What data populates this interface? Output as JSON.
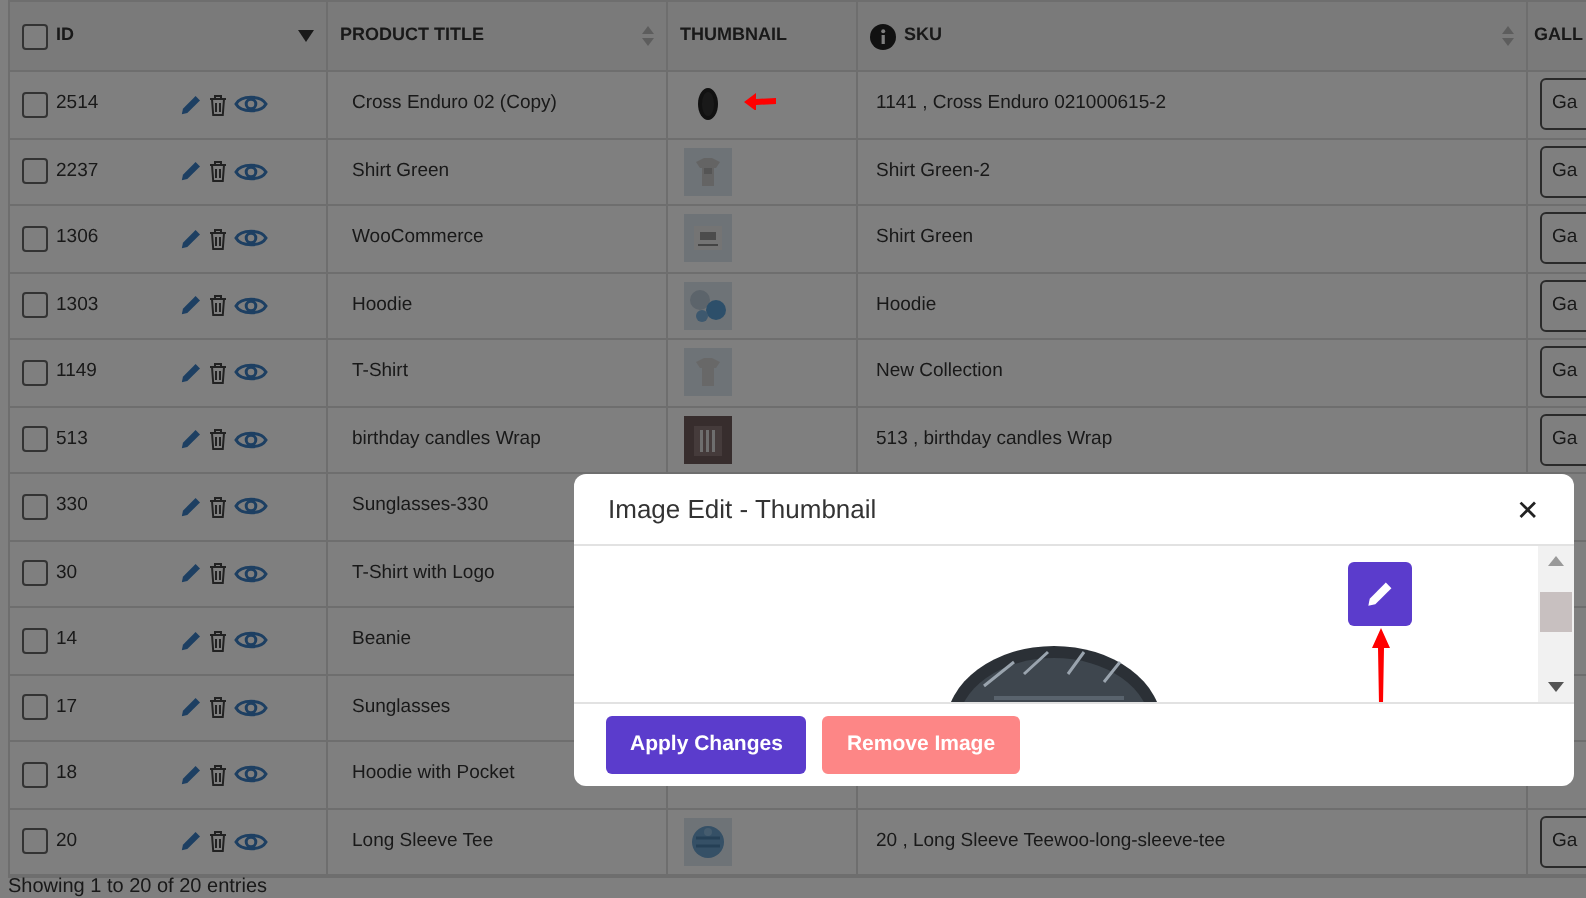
{
  "table": {
    "select_all": {
      "checked": false
    },
    "columns": [
      "ID",
      "PRODUCT TITLE",
      "THUMBNAIL",
      "SKU",
      "GALL"
    ],
    "rows": [
      {
        "checked": false,
        "id": "2514",
        "title": "Cross Enduro 02 (Copy)",
        "sku": "1141 , Cross Enduro 021000615-2",
        "gallery": "Ga"
      },
      {
        "checked": false,
        "id": "2237",
        "title": "Shirt Green",
        "sku": "Shirt Green-2",
        "gallery": "Ga"
      },
      {
        "checked": false,
        "id": "1306",
        "title": "WooCommerce",
        "sku": "Shirt Green",
        "gallery": "Ga"
      },
      {
        "checked": false,
        "id": "1303",
        "title": "Hoodie",
        "sku": "Hoodie",
        "gallery": "Ga"
      },
      {
        "checked": false,
        "id": "1149",
        "title": "T-Shirt",
        "sku": "New Collection",
        "gallery": "Ga"
      },
      {
        "checked": false,
        "id": "513",
        "title": "birthday candles Wrap",
        "sku": "513 , birthday candles Wrap",
        "gallery": "Ga"
      },
      {
        "checked": false,
        "id": "330",
        "title": "Sunglasses-330"
      },
      {
        "checked": false,
        "id": "30",
        "title": "T-Shirt with Logo"
      },
      {
        "checked": false,
        "id": "14",
        "title": "Beanie"
      },
      {
        "checked": false,
        "id": "17",
        "title": "Sunglasses"
      },
      {
        "checked": false,
        "id": "18",
        "title": "Hoodie with Pocket"
      },
      {
        "checked": false,
        "id": "20",
        "title": "Long Sleeve Tee",
        "sku": "20 , Long Sleeve Teewoo-long-sleeve-tee",
        "gallery": "Ga"
      }
    ]
  },
  "footer": "Showing 1 to 20 of 20 entries",
  "modal": {
    "title": "Image Edit - Thumbnail",
    "close": "✕",
    "buttons": [
      {
        "label": "Apply Changes",
        "kind": "primary"
      },
      {
        "label": "Remove Image",
        "kind": "danger"
      }
    ]
  }
}
